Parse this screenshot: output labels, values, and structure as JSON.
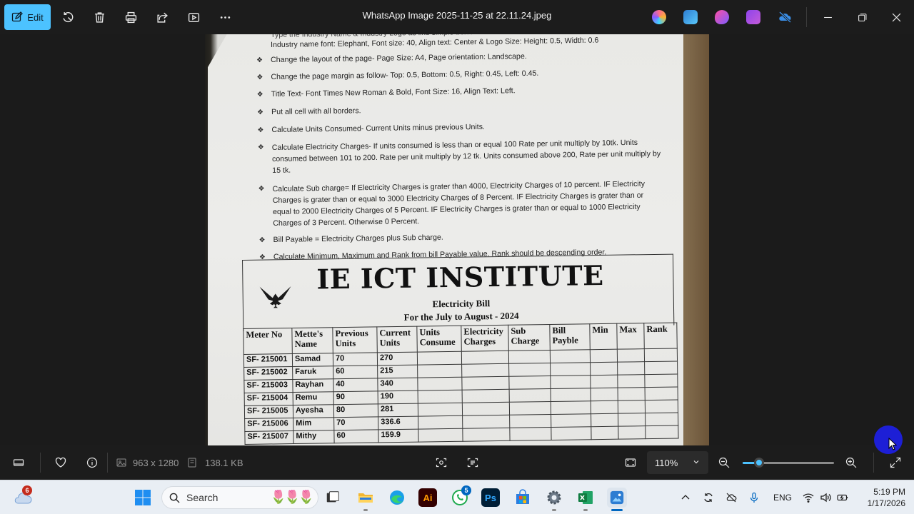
{
  "toolbar": {
    "edit_label": "Edit",
    "title": "WhatsApp Image 2025-11-25 at 22.11.24.jpeg"
  },
  "document": {
    "partial_line": "Type the Industry Name & Industry Logo as like simple below.",
    "first_line": "Industry name font: Elephant, Font size: 40, Align text: Center & Logo Size: Height: 0.5, Width: 0.6",
    "bullets": [
      "Change the layout of the page- Page Size: A4, Page orientation: Landscape.",
      "Change the page margin as follow- Top: 0.5, Bottom: 0.5, Right: 0.45, Left: 0.45.",
      "Title Text- Font Times New Roman & Bold, Font Size: 16, Align Text: Left.",
      "Put all cell with all borders.",
      "Calculate Units Consumed- Current Units minus previous Units.",
      "Calculate Electricity Charges- If units consumed is less than or equal 100 Rate per unit multiply by 10tk. Units consumed between 101 to 200. Rate per unit multiply by 12 tk. Units consumed above 200, Rate per unit multiply by 15 tk.",
      "Calculate Sub charge= If Electricity Charges is grater than 4000, Electricity Charges of 10 percent. IF Electricity Charges is grater than or equal to 3000 Electricity Charges of 8 Percent. IF Electricity Charges is grater than or equal to 2000 Electricity Charges of 5 Percent. IF Electricity Charges is grater than or equal to 1000 Electricity Charges of 3 Percent. Otherwise 0 Percent.",
      "Bill Payable = Electricity Charges plus Sub charge.",
      "Calculate Minimum, Maximum and Rank from bill Payable value. Rank should be descending order."
    ],
    "bill": {
      "institute": "IE ICT INSTITUTE",
      "subtitle": "Electricity Bill",
      "period": "For the July to August  - 2024",
      "headers": [
        "Meter No",
        "Mette's Name",
        "Previous Units",
        "Current Units",
        "Units Consume",
        "Electricity Charges",
        "Sub Charge",
        "Bill Payble",
        "Min",
        "Max",
        "Rank"
      ],
      "rows": [
        [
          "SF- 215001",
          "Samad",
          "70",
          "270"
        ],
        [
          "SF- 215002",
          "Faruk",
          "60",
          "215"
        ],
        [
          "SF- 215003",
          "Rayhan",
          "40",
          "340"
        ],
        [
          "SF- 215004",
          "Remu",
          "90",
          "190"
        ],
        [
          "SF- 215005",
          "Ayesha",
          "80",
          "281"
        ],
        [
          "SF- 215006",
          "Mim",
          "70",
          "336.6"
        ],
        [
          "SF- 215007",
          "Mithy",
          "60",
          "159.9"
        ]
      ]
    }
  },
  "bottombar": {
    "dimensions": "963 x 1280",
    "file_size": "138.1 KB",
    "zoom": "110%",
    "zoom_slider_fraction": 0.18
  },
  "taskbar": {
    "search_placeholder": "Search",
    "weather_badge": "6",
    "whatsapp_badge": "5",
    "language": "ENG",
    "time": "5:19 PM",
    "date": "1/17/2026"
  },
  "colors": {
    "accent": "#4cc2ff",
    "cursor_halo": "#1d1fd6"
  }
}
